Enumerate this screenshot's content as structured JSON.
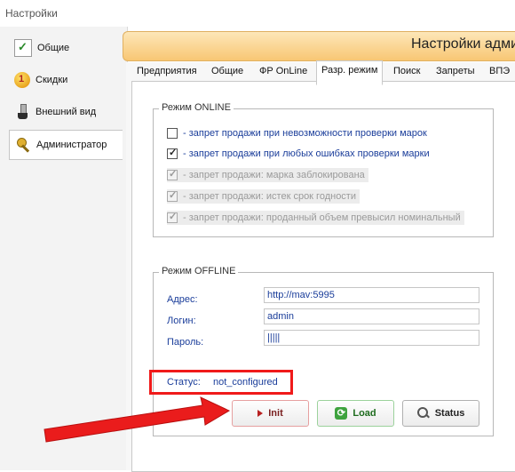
{
  "window": {
    "title": "Настройки"
  },
  "sidebar": {
    "items": [
      {
        "label": "Общие",
        "icon": "check-icon"
      },
      {
        "label": "Скидки",
        "icon": "discount-icon"
      },
      {
        "label": "Внешний вид",
        "icon": "brush-icon"
      },
      {
        "label": "Администратор",
        "icon": "keys-icon",
        "active": true
      }
    ]
  },
  "header": {
    "title": "Настройки адми"
  },
  "tabs": [
    {
      "label": "Предприятия"
    },
    {
      "label": "Общие"
    },
    {
      "label": "ФР OnLine"
    },
    {
      "label": "Разр. режим",
      "active": true
    },
    {
      "label": "Поиск"
    },
    {
      "label": "Запреты"
    },
    {
      "label": "ВПЭ"
    }
  ],
  "online": {
    "legend": "Режим ONLINE",
    "options": [
      {
        "label": "- запрет продажи при невозможности проверки марок",
        "checked": false,
        "enabled": true
      },
      {
        "label": "- запрет продажи при любых ошибках проверки марки",
        "checked": true,
        "enabled": true
      },
      {
        "label": "- запрет продажи: марка заблокирована",
        "checked": true,
        "enabled": false
      },
      {
        "label": "- запрет продажи: истек срок годности",
        "checked": true,
        "enabled": false
      },
      {
        "label": "- запрет продажи: проданный объем превысил номинальный",
        "checked": true,
        "enabled": false
      }
    ]
  },
  "offline": {
    "legend": "Режим OFFLINE",
    "address_label": "Адрес:",
    "address_value": "http://mav:5995",
    "login_label": "Логин:",
    "login_value": "admin",
    "password_label": "Пароль:",
    "password_value": "|||||",
    "status_label": "Статус:",
    "status_value": "not_configured"
  },
  "buttons": {
    "init": "Init",
    "load": "Load",
    "status": "Status"
  },
  "colors": {
    "accent_red": "#f01a1a",
    "label_blue": "#1a3d9a",
    "header_orange": "#f8c774"
  }
}
